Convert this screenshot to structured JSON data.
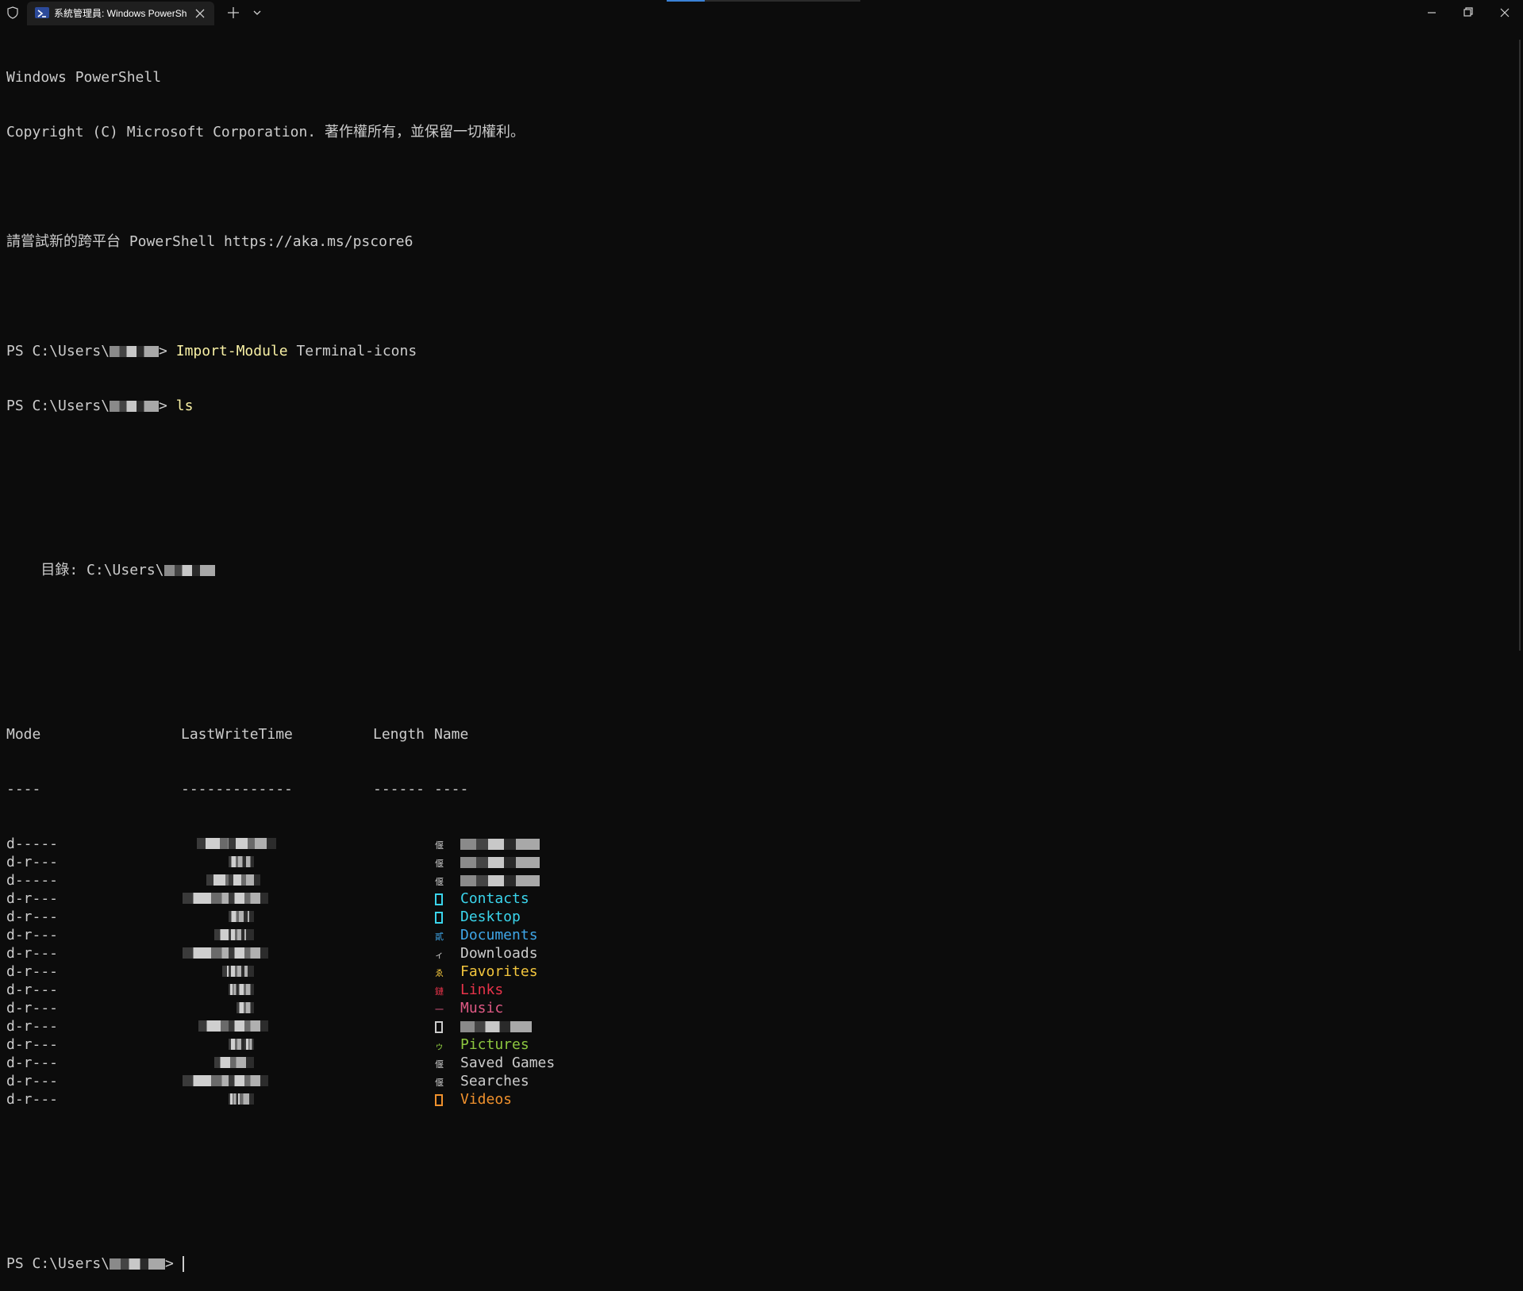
{
  "window": {
    "tab_title": "系統管理員: Windows PowerSh",
    "colors": {
      "background": "#0c0c0c",
      "tab_background": "#1f1f1f",
      "foreground": "#cccccc",
      "accent": "#3b82d6"
    }
  },
  "icons": {
    "shield": "shield-icon",
    "tab": "powershell-icon",
    "close_tab": "close-icon",
    "new_tab": "plus-icon",
    "dropdown": "chevron-down-icon",
    "minimize": "minimize-icon",
    "maximize": "restore-icon",
    "close_window": "close-icon"
  },
  "terminal": {
    "banner_line1": "Windows PowerShell",
    "banner_line2": "Copyright (C) Microsoft Corporation. 著作權所有，並保留一切權利。",
    "banner_line3": "請嘗試新的跨平台 PowerShell https://aka.ms/pscore6",
    "prompt_prefix": "PS C:\\Users\\",
    "prompt_suffix": "> ",
    "command1": "Import-Module",
    "command1_args": " Terminal-icons",
    "command2": "ls",
    "directory_label": "    目錄: C:\\Users\\",
    "headers": {
      "mode": "Mode",
      "time": "LastWriteTime",
      "length": "Length",
      "name": "Name"
    },
    "underlines": {
      "mode": "----",
      "time": "-------------",
      "length": "------",
      "name": "----"
    },
    "entries": [
      {
        "mode": "d-----",
        "icon": "folder-icon",
        "icon_glyph": "偃",
        "icon_color": "#cccccc",
        "name": "",
        "name_color": "#cccccc"
      },
      {
        "mode": "d-r---",
        "icon": "folder-icon",
        "icon_glyph": "偃",
        "icon_color": "#cccccc",
        "name": "",
        "name_color": "#cccccc"
      },
      {
        "mode": "d-----",
        "icon": "folder-icon",
        "icon_glyph": "偃",
        "icon_color": "#cccccc",
        "name": "",
        "name_color": "#cccccc"
      },
      {
        "mode": "d-r---",
        "icon": "contacts-icon",
        "icon_glyph": "",
        "icon_color": "#3ad5ec",
        "name": "Contacts",
        "name_color": "#3ad5ec"
      },
      {
        "mode": "d-r---",
        "icon": "desktop-icon",
        "icon_glyph": "",
        "icon_color": "#3ad5ec",
        "name": "Desktop",
        "name_color": "#3ad5ec"
      },
      {
        "mode": "d-r---",
        "icon": "documents-icon",
        "icon_glyph": "貳",
        "icon_color": "#3fa6e8",
        "name": "Documents",
        "name_color": "#3fa6e8"
      },
      {
        "mode": "d-r---",
        "icon": "downloads-icon",
        "icon_glyph": "ィ",
        "icon_color": "#cccccc",
        "name": "Downloads",
        "name_color": "#cccccc"
      },
      {
        "mode": "d-r---",
        "icon": "favorites-icon",
        "icon_glyph": "ゑ",
        "icon_color": "#f2c53d",
        "name": "Favorites",
        "name_color": "#f2c53d"
      },
      {
        "mode": "d-r---",
        "icon": "links-icon",
        "icon_glyph": "鏈",
        "icon_color": "#e8334a",
        "name": "Links",
        "name_color": "#e8334a"
      },
      {
        "mode": "d-r---",
        "icon": "music-icon",
        "icon_glyph": "一",
        "icon_color": "#e05a85",
        "name": "Music",
        "name_color": "#e05a85"
      },
      {
        "mode": "d-r---",
        "icon": "onedrive-icon",
        "icon_glyph": "",
        "icon_color": "#cccccc",
        "name": "",
        "name_color": "#cccccc"
      },
      {
        "mode": "d-r---",
        "icon": "pictures-icon",
        "icon_glyph": "ゥ",
        "icon_color": "#8cc63f",
        "name": "Pictures",
        "name_color": "#8cc63f"
      },
      {
        "mode": "d-r---",
        "icon": "folder-icon",
        "icon_glyph": "偃",
        "icon_color": "#cccccc",
        "name": "Saved Games",
        "name_color": "#cccccc"
      },
      {
        "mode": "d-r---",
        "icon": "folder-icon",
        "icon_glyph": "偃",
        "icon_color": "#cccccc",
        "name": "Searches",
        "name_color": "#cccccc"
      },
      {
        "mode": "d-r---",
        "icon": "videos-icon",
        "icon_glyph": "",
        "icon_color": "#f0912d",
        "name": "Videos",
        "name_color": "#f0912d"
      }
    ]
  }
}
